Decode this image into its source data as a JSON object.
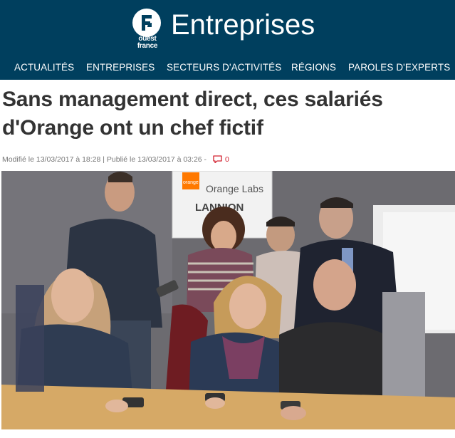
{
  "brand": {
    "logo_text_line1": "ouest",
    "logo_text_line2": "france",
    "section_title": "Entreprises",
    "colors": {
      "header_bg": "#003f5e",
      "comment_red": "#d2202f"
    }
  },
  "nav": {
    "items": [
      {
        "label": "ACTUALITÉS"
      },
      {
        "label": "ENTREPRISES"
      },
      {
        "label": "SECTEURS D'ACTIVITÉS"
      },
      {
        "label": "RÉGIONS"
      },
      {
        "label": "PAROLES D'EXPERTS"
      }
    ]
  },
  "article": {
    "title": "Sans management direct, ces salariés d'Orange ont un chef fictif",
    "modified": "Modifié le 13/03/2017 à 18:28",
    "separator": " | ",
    "published": "Publié le 13/03/2017 à 03:26",
    "dash": " -",
    "comments_icon": "comment-bubble-icon",
    "comments_count": "0"
  },
  "photo": {
    "sign_brand": "orange",
    "sign_line1": "Orange Labs",
    "sign_line2": "LANNION"
  }
}
